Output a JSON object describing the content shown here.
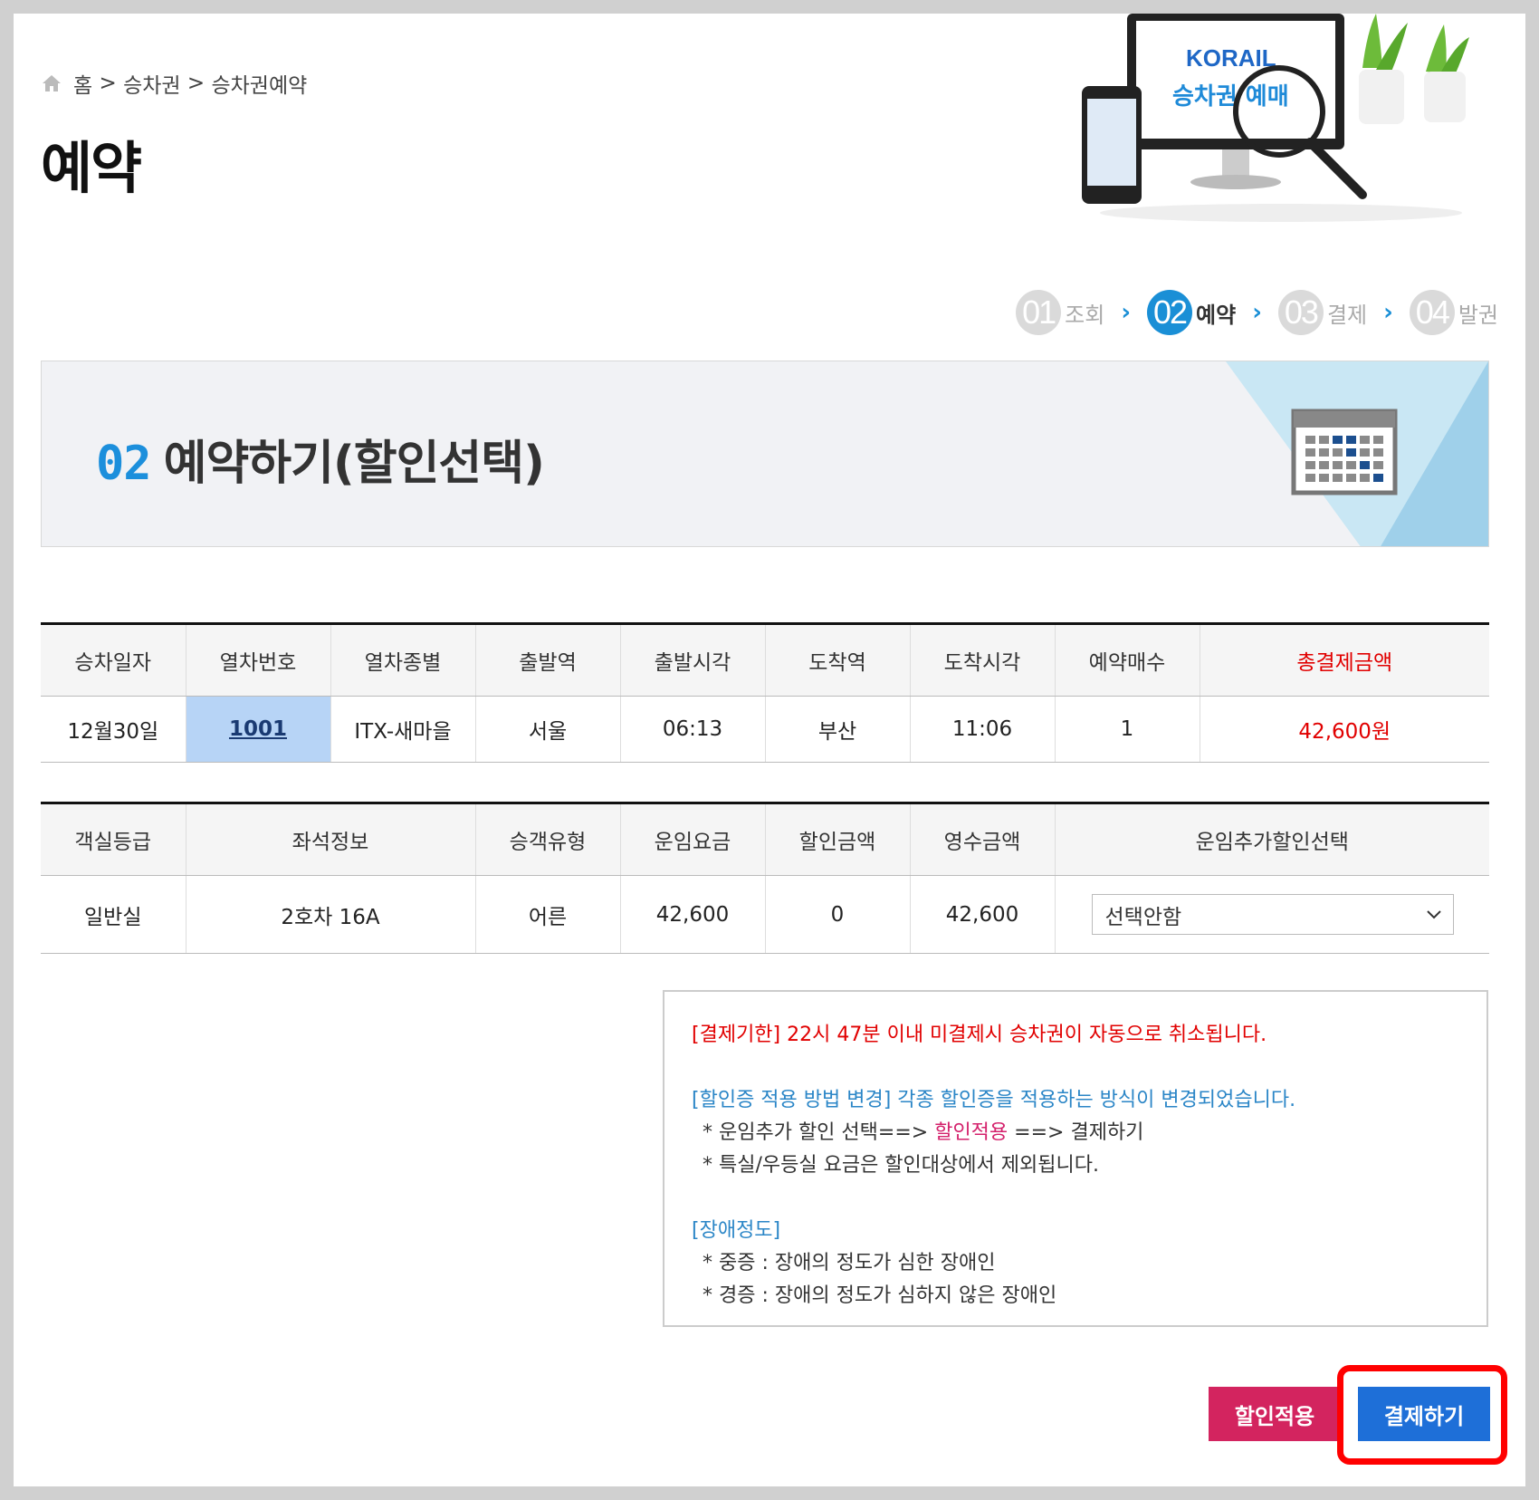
{
  "breadcrumb": {
    "home": "홈",
    "sep1": " > ",
    "ticket": "승차권",
    "sep2": " > ",
    "reservation": "승차권예약"
  },
  "page_title": "예약",
  "hero": {
    "brand": "KORAIL",
    "caption": "승차권 예매"
  },
  "steps": [
    {
      "num": "01",
      "label": "조회",
      "active": false
    },
    {
      "num": "02",
      "label": "예약",
      "active": true
    },
    {
      "num": "03",
      "label": "결제",
      "active": false
    },
    {
      "num": "04",
      "label": "발권",
      "active": false
    }
  ],
  "banner": {
    "num": "02",
    "title": "예약하기(할인선택)"
  },
  "train_table": {
    "headers": [
      "승차일자",
      "열차번호",
      "열차종별",
      "출발역",
      "출발시각",
      "도착역",
      "도착시각",
      "예약매수",
      "총결제금액"
    ],
    "row": {
      "date": "12월30일",
      "train_no": "1001",
      "train_type": "ITX-새마을",
      "dep_station": "서울",
      "dep_time": "06:13",
      "arr_station": "부산",
      "arr_time": "11:06",
      "count": "1",
      "total": "42,600원"
    }
  },
  "fare_table": {
    "headers": [
      "객실등급",
      "좌석정보",
      "승객유형",
      "운임요금",
      "할인금액",
      "영수금액",
      "운임추가할인선택"
    ],
    "row": {
      "class": "일반실",
      "seat": "2호차 16A",
      "passenger": "어른",
      "fare": "42,600",
      "discount": "0",
      "received": "42,600",
      "discount_select": "선택안함"
    }
  },
  "notice": {
    "deadline_tag": "[결제기한]",
    "deadline_text": " 22시 47분 이내 미결제시 승차권이 자동으로 취소됩니다.",
    "method_tag": "[할인증 적용 방법 변경]",
    "method_text": " 각종 할인증을 적용하는 방식이 변경되었습니다.",
    "method_line1_a": "* 운임추가 할인 선택==> ",
    "method_line1_b": "할인적용",
    "method_line1_c": " ==> 결제하기",
    "method_line2": "* 특실/우등실 요금은 할인대상에서 제외됩니다.",
    "disability_tag": "[장애정도]",
    "disability_line1": "* 중증 : 장애의 정도가 심한 장애인",
    "disability_line2": "* 경증 : 장애의 정도가 심하지 않은 장애인"
  },
  "buttons": {
    "apply_discount": "할인적용",
    "pay": "결제하기"
  },
  "colors": {
    "accent_blue": "#1a8fd6",
    "total_red": "#e10000",
    "discount_btn": "#d3245f",
    "pay_btn": "#1e6fd8",
    "highlight": "#ff0000"
  }
}
